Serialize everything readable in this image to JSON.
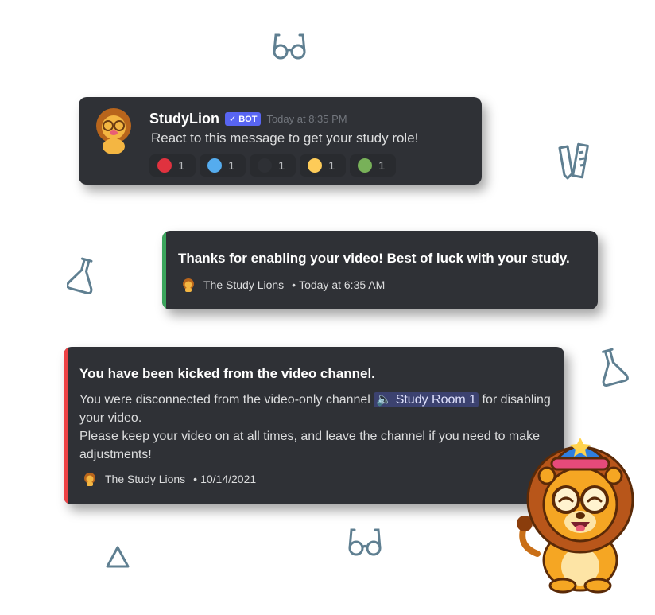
{
  "message": {
    "username": "StudyLion",
    "bot_tag": "BOT",
    "timestamp": "Today at 8:35 PM",
    "text": "React to this message to get your study role!",
    "reactions": [
      {
        "color": "#e0323f",
        "count": "1"
      },
      {
        "color": "#55acee",
        "count": "1"
      },
      {
        "color": "#2e3035",
        "count": "1"
      },
      {
        "color": "#fdcb58",
        "count": "1"
      },
      {
        "color": "#78b159",
        "count": "1"
      }
    ]
  },
  "embed_success": {
    "accent": "#3ba55c",
    "title": "Thanks for enabling your video! Best of luck with your study.",
    "footer_name": "The Study Lions",
    "footer_sep": "•",
    "footer_time": "Today at 6:35 AM"
  },
  "embed_kick": {
    "accent": "#ed4245",
    "title": "You have been kicked from the video channel.",
    "desc_part1": "You were disconnected from the video-only channel ",
    "channel_mention": "Study Room 1",
    "desc_part2": " for disabling your video.",
    "desc_line2": "Please keep your video on at all times, and leave the channel if you need to make adjustments!",
    "footer_name": "The Study Lions",
    "footer_sep": "•",
    "footer_time": "10/14/2021"
  }
}
